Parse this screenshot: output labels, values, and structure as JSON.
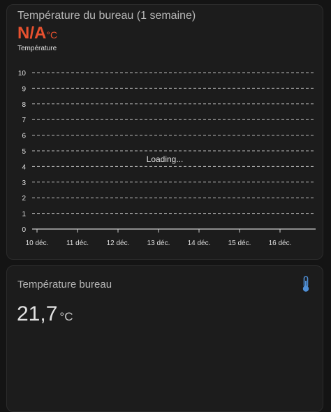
{
  "chart_card": {
    "title": "Température du bureau (1 semaine)",
    "value": "N/A",
    "unit": "°C",
    "series_label": "Température",
    "loading_text": "Loading...",
    "value_color": "#e8512f"
  },
  "chart_data": {
    "type": "line",
    "title": "",
    "xlabel": "",
    "ylabel": "",
    "x_ticks": [
      "10 déc.",
      "11 déc.",
      "12 déc.",
      "13 déc.",
      "14 déc.",
      "15 déc.",
      "16 déc."
    ],
    "y_ticks": [
      0,
      1,
      2,
      3,
      4,
      5,
      6,
      7,
      8,
      9,
      10
    ],
    "ylim": [
      0,
      10
    ],
    "grid": true,
    "series": []
  },
  "sensor_card": {
    "title": "Température bureau",
    "value": "21,7",
    "unit": "°C",
    "icon": "thermometer-icon",
    "icon_color": "#4f8fd6"
  }
}
